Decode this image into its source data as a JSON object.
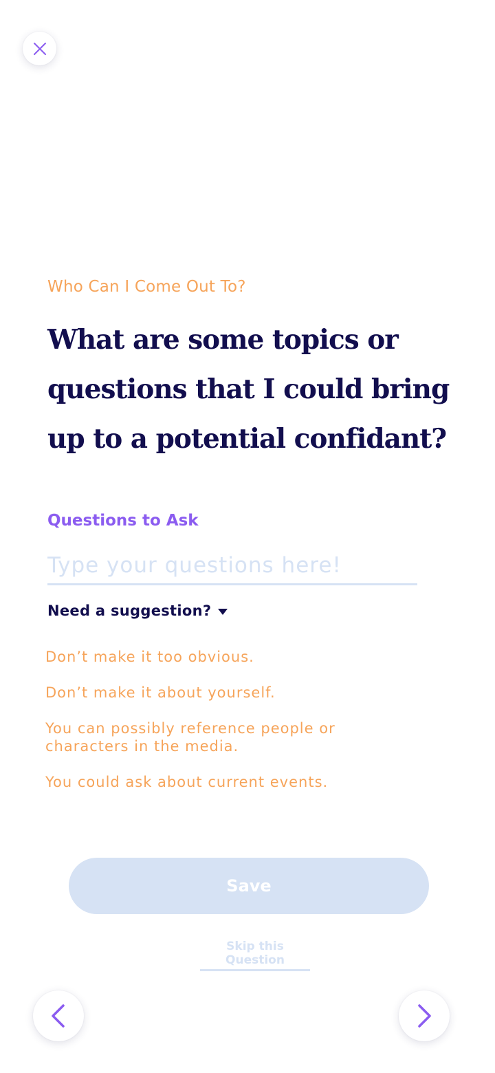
{
  "header": {
    "close_icon": "close-icon"
  },
  "prompt": {
    "category": "Who Can I Come Out To?",
    "question": "What are some topics or questions that I could bring up to a potential confidant?"
  },
  "form": {
    "field_label": "Questions to Ask",
    "input_value": "",
    "input_placeholder": "Type your questions here!",
    "suggestion_toggle": "Need a suggestion?",
    "suggestions": [
      "Don’t make it too obvious.",
      "Don’t make it about yourself.",
      "You can possibly reference people or characters in the media.",
      "You could ask about current events."
    ]
  },
  "actions": {
    "save_label": "Save",
    "skip_label": "Skip this Question"
  },
  "navigation": {
    "prev_icon": "chevron-left-icon",
    "next_icon": "chevron-right-icon"
  },
  "colors": {
    "accent_orange": "#F6A45A",
    "accent_purple": "#8B5CF0",
    "heading_navy": "#120E4E",
    "disabled_blue": "#D6E2F4"
  }
}
